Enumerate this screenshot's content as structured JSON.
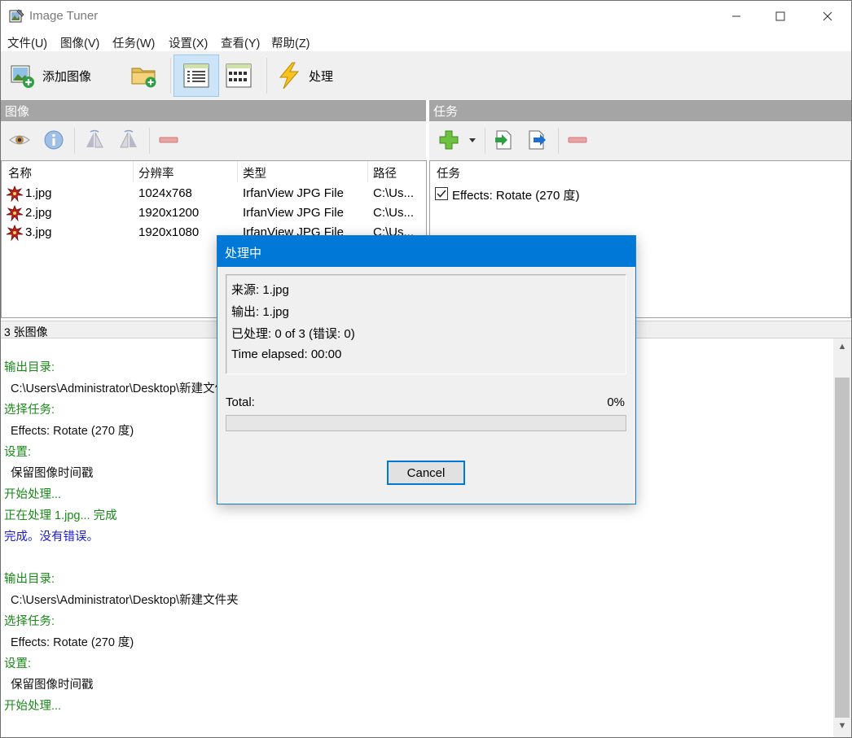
{
  "window": {
    "title": "Image Tuner"
  },
  "window_controls": {
    "minimize": "—",
    "maximize": "☐",
    "close": "✕"
  },
  "menu": [
    "文件(U)",
    "图像(V)",
    "任务(W)",
    "设置(X)",
    "查看(Y)",
    "帮助(Z)"
  ],
  "toolbar": {
    "add_images_label": "添加图像",
    "process_label": "处理"
  },
  "icons": {
    "app": "image-tuner-icon",
    "add_images": "add-image-icon",
    "add_folder": "add-folder-icon",
    "details_view": "details-view-icon",
    "thumbnail_view": "thumbnail-view-icon",
    "process": "lightning-icon"
  },
  "images_panel": {
    "header": "图像",
    "columns": [
      "名称",
      "分辨率",
      "类型",
      "路径"
    ],
    "rows": [
      {
        "name": "1.jpg",
        "resolution": "1024x768",
        "type": "IrfanView JPG File",
        "path": "C:\\Us..."
      },
      {
        "name": "2.jpg",
        "resolution": "1920x1200",
        "type": "IrfanView JPG File",
        "path": "C:\\Us..."
      },
      {
        "name": "3.jpg",
        "resolution": "1920x1080",
        "type": "IrfanView JPG File",
        "path": "C:\\Us..."
      }
    ]
  },
  "tasks_panel": {
    "header": "任务",
    "column": "任务",
    "tasks": [
      {
        "label": "Effects: Rotate (270 度)",
        "checked": true
      }
    ]
  },
  "status": {
    "text": "3 张图像"
  },
  "log": [
    {
      "text": "输出目录:",
      "color": "green",
      "indent": false
    },
    {
      "text": "C:\\Users\\Administrator\\Desktop\\新建文件夹",
      "color": "black",
      "indent": true
    },
    {
      "text": "选择任务:",
      "color": "green",
      "indent": false
    },
    {
      "text": "Effects: Rotate (270 度)",
      "color": "black",
      "indent": true
    },
    {
      "text": "设置:",
      "color": "green",
      "indent": false
    },
    {
      "text": "保留图像时间戳",
      "color": "black",
      "indent": true
    },
    {
      "text": "开始处理...",
      "color": "green",
      "indent": false
    },
    {
      "text": "正在处理 1.jpg... 完成",
      "color": "green",
      "indent": false
    },
    {
      "text": "完成。没有错误。",
      "color": "blue",
      "indent": false
    },
    {
      "text": "",
      "color": "black",
      "indent": false
    },
    {
      "text": "输出目录:",
      "color": "green",
      "indent": false
    },
    {
      "text": "C:\\Users\\Administrator\\Desktop\\新建文件夹",
      "color": "black",
      "indent": true
    },
    {
      "text": "选择任务:",
      "color": "green",
      "indent": false
    },
    {
      "text": "Effects: Rotate (270 度)",
      "color": "black",
      "indent": true
    },
    {
      "text": "设置:",
      "color": "green",
      "indent": false
    },
    {
      "text": "保留图像时间戳",
      "color": "black",
      "indent": true
    },
    {
      "text": "开始处理...",
      "color": "green",
      "indent": false
    }
  ],
  "dialog": {
    "title": "处理中",
    "source": "来源: 1.jpg",
    "output": "输出: 1.jpg",
    "processed": "已处理: 0 of 3 (错误: 0)",
    "elapsed": "Time elapsed: 00:00",
    "total_label": "Total:",
    "total_percent": "0%",
    "progress": 0,
    "cancel_label": "Cancel"
  },
  "colors": {
    "accent": "#0078d7",
    "log_green": "#1a8a1a",
    "log_blue": "#1a1ad0",
    "section_header": "#a5a5a5"
  }
}
